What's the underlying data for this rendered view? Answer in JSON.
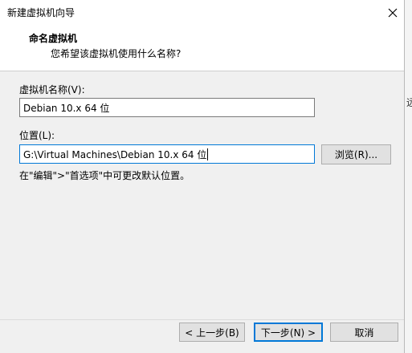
{
  "window": {
    "title": "新建虚拟机向导",
    "close_icon": "close-icon"
  },
  "header": {
    "title": "命名虚拟机",
    "subtitle": "您希望该虚拟机使用什么名称?"
  },
  "form": {
    "name_label": "虚拟机名称(V):",
    "name_value": "Debian 10.x 64 位",
    "location_label": "位置(L):",
    "location_value": "G:\\Virtual Machines\\Debian 10.x 64 位",
    "browse_label": "浏览(R)...",
    "hint": "在\"编辑\">\"首选项\"中可更改默认位置。"
  },
  "footer": {
    "back_label": "< 上一步(B)",
    "next_label": "下一步(N) >",
    "cancel_label": "取消"
  },
  "background_peek": "远",
  "colors": {
    "accent": "#0078d7",
    "dialog_body": "#f0f0f0",
    "button": "#e1e1e1"
  }
}
